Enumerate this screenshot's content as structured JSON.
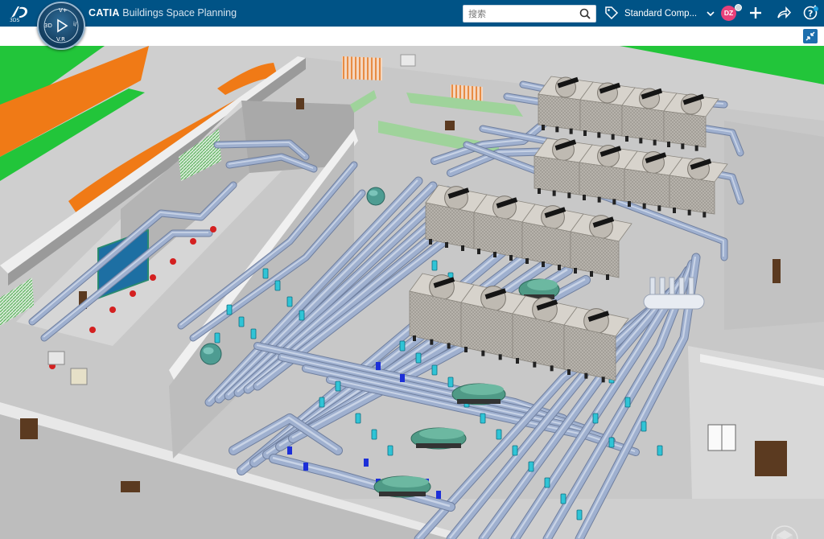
{
  "header": {
    "brand": "CATIA",
    "app_name": "Buildings Space Planning",
    "search": {
      "placeholder": "搜索",
      "value": ""
    },
    "collab_space": "Standard Comp...",
    "user_initials": "DZ"
  },
  "compass": {
    "label_3d": "3D",
    "label_v": "V.R",
    "label_top": "V+",
    "label_right": "i/"
  },
  "icons": {
    "logo": "3ds-logo-icon",
    "search": "search-icon",
    "tag": "tag-icon",
    "dropdown": "chevron-down-icon",
    "add": "plus-icon",
    "share": "share-icon",
    "help": "help-icon",
    "collapse": "collapse-icon",
    "navigator": "nav-cube-icon"
  },
  "colors": {
    "topbar": "#005386",
    "pipe": "#9fb0cf",
    "chiller": "#4f9a86",
    "valve": "#2fc4d6",
    "floor": "#cfcfcf",
    "grass": "#22c53a",
    "path": "#f07a16"
  }
}
